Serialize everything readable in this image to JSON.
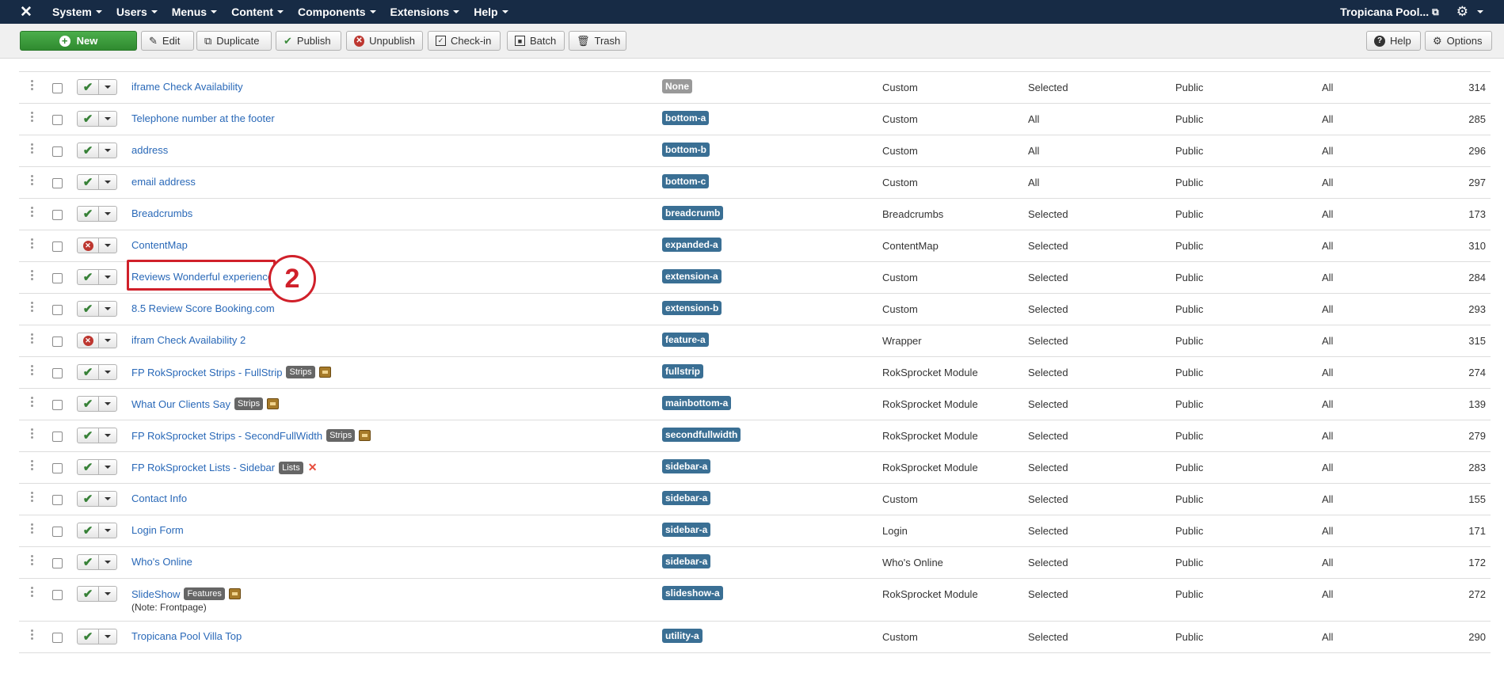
{
  "navbar": {
    "menus": [
      "System",
      "Users",
      "Menus",
      "Content",
      "Components",
      "Extensions",
      "Help"
    ],
    "site_name": "Tropicana Pool..."
  },
  "toolbar": {
    "new": "New",
    "edit": "Edit",
    "duplicate": "Duplicate",
    "publish": "Publish",
    "unpublish": "Unpublish",
    "checkin": "Check-in",
    "batch": "Batch",
    "trash": "Trash",
    "help": "Help",
    "options": "Options"
  },
  "annotation": {
    "number": "2"
  },
  "rows": [
    {
      "title": "iframe Check Availability",
      "status": "published",
      "position": "None",
      "type": "Custom",
      "pages": "Selected",
      "access": "Public",
      "language": "All",
      "id": "314"
    },
    {
      "title": "Telephone number at the footer",
      "status": "published",
      "position": "bottom-a",
      "type": "Custom",
      "pages": "All",
      "access": "Public",
      "language": "All",
      "id": "285"
    },
    {
      "title": "address",
      "status": "published",
      "position": "bottom-b",
      "type": "Custom",
      "pages": "All",
      "access": "Public",
      "language": "All",
      "id": "296"
    },
    {
      "title": "email address",
      "status": "published",
      "position": "bottom-c",
      "type": "Custom",
      "pages": "All",
      "access": "Public",
      "language": "All",
      "id": "297"
    },
    {
      "title": "Breadcrumbs",
      "status": "published",
      "position": "breadcrumb",
      "type": "Breadcrumbs",
      "pages": "Selected",
      "access": "Public",
      "language": "All",
      "id": "173"
    },
    {
      "title": "ContentMap",
      "status": "unpublished",
      "position": "expanded-a",
      "type": "ContentMap",
      "pages": "Selected",
      "access": "Public",
      "language": "All",
      "id": "310"
    },
    {
      "title": "Reviews Wonderful experience",
      "status": "published",
      "position": "extension-a",
      "type": "Custom",
      "pages": "Selected",
      "access": "Public",
      "language": "All",
      "id": "284"
    },
    {
      "title": "8.5 Review Score Booking.com",
      "status": "published",
      "position": "extension-b",
      "type": "Custom",
      "pages": "Selected",
      "access": "Public",
      "language": "All",
      "id": "293"
    },
    {
      "title": "ifram Check Availability 2",
      "status": "unpublished",
      "position": "feature-a",
      "type": "Wrapper",
      "pages": "Selected",
      "access": "Public",
      "language": "All",
      "id": "315"
    },
    {
      "title": "FP RokSprocket Strips - FullStrip",
      "label": "Strips",
      "icon": "package-icon",
      "status": "published",
      "position": "fullstrip",
      "type": "RokSprocket Module",
      "pages": "Selected",
      "access": "Public",
      "language": "All",
      "id": "274"
    },
    {
      "title": "What Our Clients Say",
      "label": "Strips",
      "icon": "package-icon",
      "status": "published",
      "position": "mainbottom-a",
      "type": "RokSprocket Module",
      "pages": "Selected",
      "access": "Public",
      "language": "All",
      "id": "139"
    },
    {
      "title": "FP RokSprocket Strips - SecondFullWidth",
      "label": "Strips",
      "icon": "package-icon",
      "status": "published",
      "position": "secondfullwidth",
      "type": "RokSprocket Module",
      "pages": "Selected",
      "access": "Public",
      "language": "All",
      "id": "279"
    },
    {
      "title": "FP RokSprocket Lists - Sidebar",
      "label": "Lists",
      "icon": "joomla-icon",
      "status": "published",
      "position": "sidebar-a",
      "type": "RokSprocket Module",
      "pages": "Selected",
      "access": "Public",
      "language": "All",
      "id": "283"
    },
    {
      "title": "Contact Info",
      "status": "published",
      "position": "sidebar-a",
      "type": "Custom",
      "pages": "Selected",
      "access": "Public",
      "language": "All",
      "id": "155"
    },
    {
      "title": "Login Form",
      "status": "published",
      "position": "sidebar-a",
      "type": "Login",
      "pages": "Selected",
      "access": "Public",
      "language": "All",
      "id": "171"
    },
    {
      "title": "Who's Online",
      "status": "published",
      "position": "sidebar-a",
      "type": "Who's Online",
      "pages": "Selected",
      "access": "Public",
      "language": "All",
      "id": "172"
    },
    {
      "title": "SlideShow",
      "label": "Features",
      "icon": "package-icon",
      "note": "(Note: Frontpage)",
      "status": "published",
      "position": "slideshow-a",
      "type": "RokSprocket Module",
      "pages": "Selected",
      "access": "Public",
      "language": "All",
      "id": "272"
    },
    {
      "title": "Tropicana Pool Villa Top",
      "status": "published",
      "position": "utility-a",
      "type": "Custom",
      "pages": "Selected",
      "access": "Public",
      "language": "All",
      "id": "290"
    }
  ]
}
